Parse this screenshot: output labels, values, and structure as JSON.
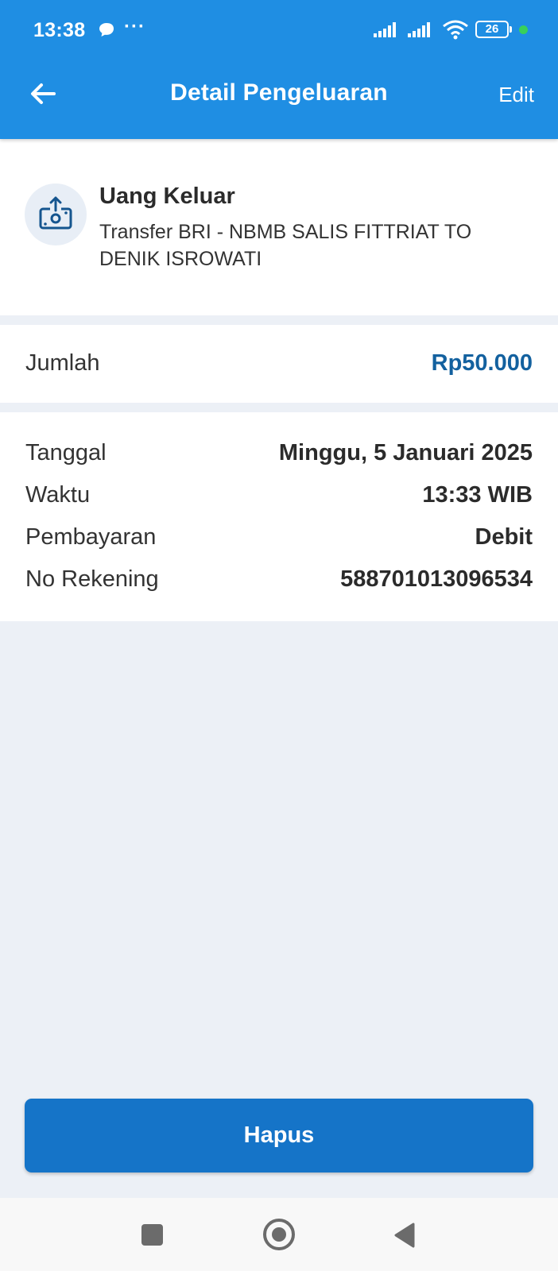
{
  "status_bar": {
    "time": "13:38",
    "more": "···",
    "battery": "26"
  },
  "header": {
    "title": "Detail Pengeluaran",
    "edit_label": "Edit"
  },
  "transaction": {
    "type": "Uang Keluar",
    "description": "Transfer BRI - NBMB SALIS FITTRIAT TO DENIK ISROWATI",
    "icon": "money-out-icon"
  },
  "amount": {
    "label": "Jumlah",
    "value": "Rp50.000"
  },
  "details": [
    {
      "label": "Tanggal",
      "value": "Minggu, 5 Januari 2025"
    },
    {
      "label": "Waktu",
      "value": "13:33 WIB"
    },
    {
      "label": "Pembayaran",
      "value": "Debit"
    },
    {
      "label": "No Rekening",
      "value": "588701013096534"
    }
  ],
  "actions": {
    "delete_label": "Hapus"
  },
  "colors": {
    "primary": "#1f8ee3",
    "button": "#1574c8",
    "amount": "#13619f",
    "background": "#ecf0f6"
  }
}
